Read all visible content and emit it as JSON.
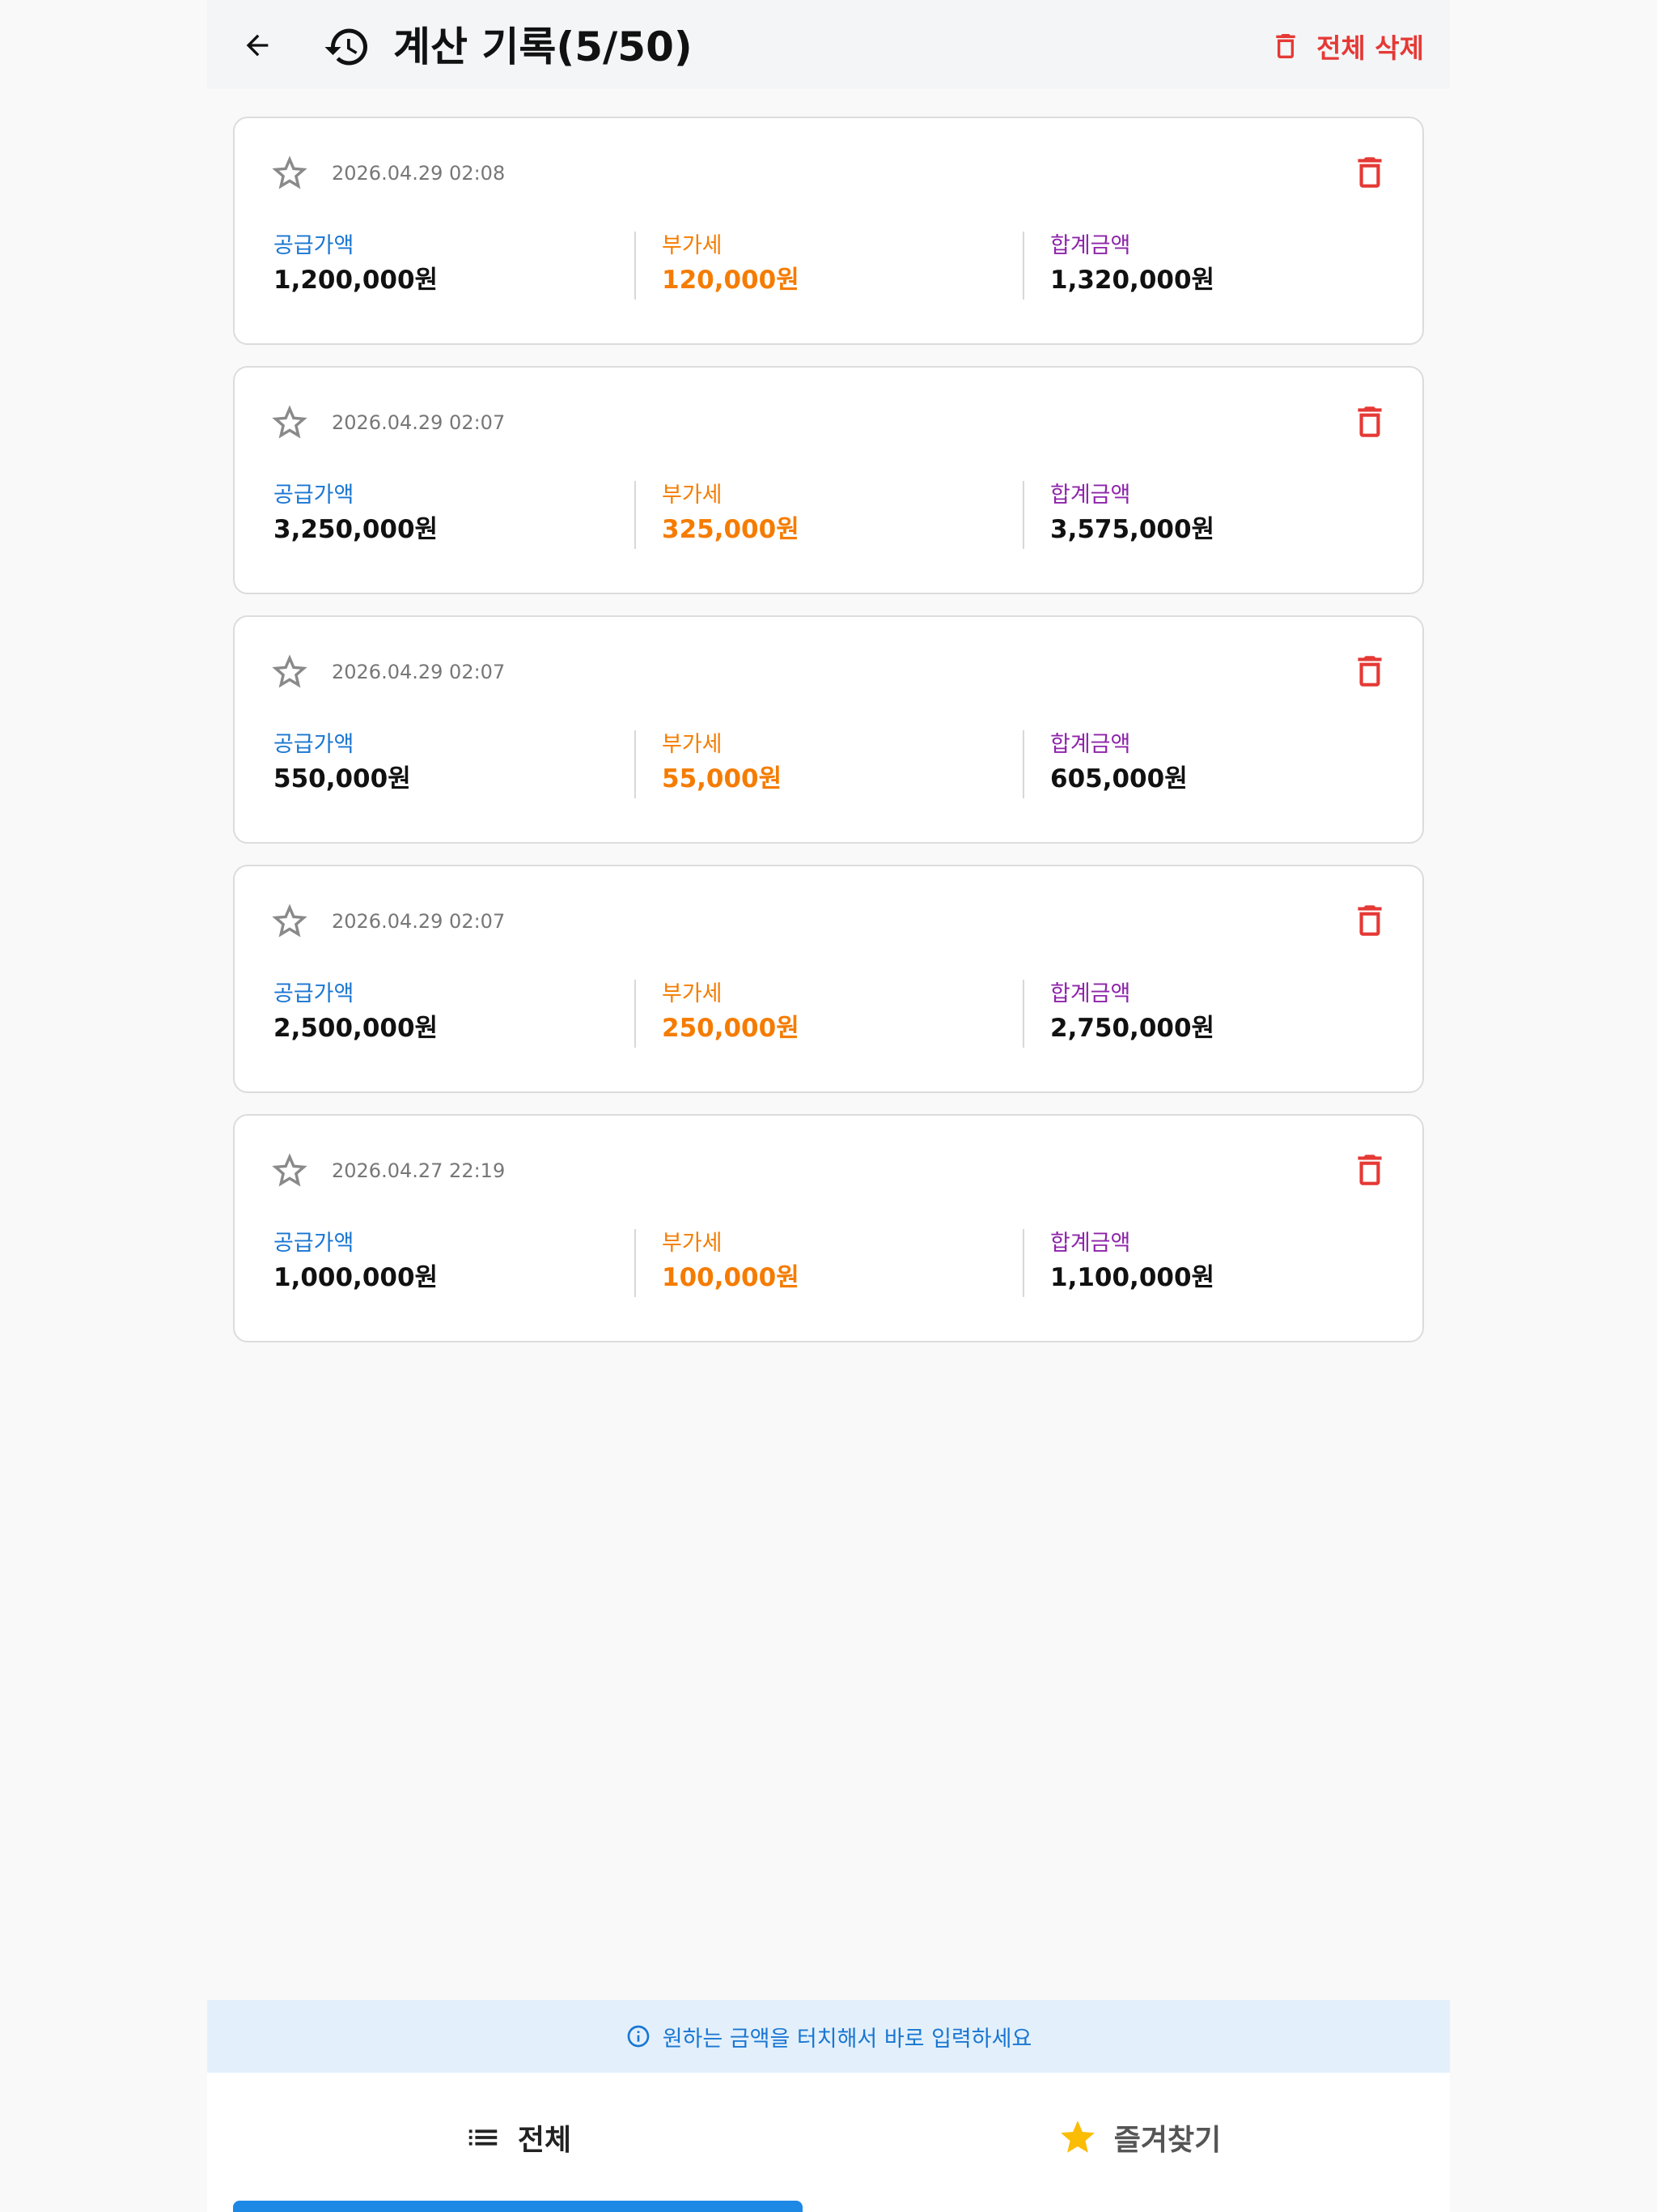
{
  "appbar": {
    "title": "계산 기록(5/50)",
    "delete_all_label": "전체 삭제",
    "back_icon": "arrow-left-icon",
    "history_icon": "history-icon"
  },
  "records": [
    {
      "date": "2026.04.29 02:08",
      "supply_label": "공급가액",
      "supply": "1,200,000원",
      "vat_label": "부가세",
      "vat": "120,000원",
      "total_label": "합계금액",
      "total": "1,320,000원",
      "favorite": false
    },
    {
      "date": "2026.04.29 02:07",
      "supply_label": "공급가액",
      "supply": "3,250,000원",
      "vat_label": "부가세",
      "vat": "325,000원",
      "total_label": "합계금액",
      "total": "3,575,000원",
      "favorite": false
    },
    {
      "date": "2026.04.29 02:07",
      "supply_label": "공급가액",
      "supply": "550,000원",
      "vat_label": "부가세",
      "vat": "55,000원",
      "total_label": "합계금액",
      "total": "605,000원",
      "favorite": false
    },
    {
      "date": "2026.04.29 02:07",
      "supply_label": "공급가액",
      "supply": "2,500,000원",
      "vat_label": "부가세",
      "vat": "250,000원",
      "total_label": "합계금액",
      "total": "2,750,000원",
      "favorite": false
    },
    {
      "date": "2026.04.27 22:19",
      "supply_label": "공급가액",
      "supply": "1,000,000원",
      "vat_label": "부가세",
      "vat": "100,000원",
      "total_label": "합계금액",
      "total": "1,100,000원",
      "favorite": false
    }
  ],
  "hint": {
    "text": "원하는 금액을 터치해서 바로 입력하세요",
    "icon": "info-icon"
  },
  "tabs": [
    {
      "label": "전체",
      "icon": "list-icon",
      "selected": true
    },
    {
      "label": "즐겨찾기",
      "icon": "star-icon",
      "selected": false
    }
  ],
  "colors": {
    "supply": "#1976d2",
    "vat": "#f57c00",
    "total": "#8e24aa",
    "delete": "#e53935",
    "accent": "#1e88e5",
    "favorite_star": "#fbbc04"
  }
}
